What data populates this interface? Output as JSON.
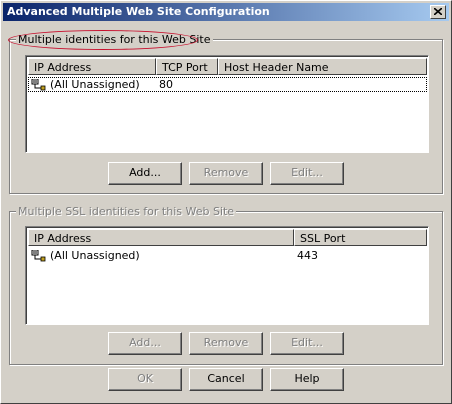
{
  "window": {
    "title": "Advanced Multiple Web Site Configuration",
    "close_icon": "close-icon"
  },
  "colors": {
    "titlebar_start": "#0a246a",
    "titlebar_end": "#a6caf0",
    "dialog_bg": "#d4d0c8",
    "annotation": "#c8102e"
  },
  "identities": {
    "label": "Multiple identities for this Web Site",
    "columns": [
      "IP Address",
      "TCP Port",
      "Host Header Name"
    ],
    "rows": [
      {
        "icon": "network-icon",
        "ip": "(All Unassigned)",
        "port": "80",
        "host": ""
      }
    ],
    "add_label": "Add...",
    "remove_label": "Remove",
    "edit_label": "Edit..."
  },
  "ssl": {
    "label": "Multiple SSL identities for this Web Site",
    "columns": [
      "IP Address",
      "SSL Port"
    ],
    "rows": [
      {
        "icon": "network-icon",
        "ip": "(All Unassigned)",
        "port": "443"
      }
    ],
    "add_label": "Add...",
    "remove_label": "Remove",
    "edit_label": "Edit..."
  },
  "footer": {
    "ok_label": "OK",
    "cancel_label": "Cancel",
    "help_label": "Help"
  }
}
